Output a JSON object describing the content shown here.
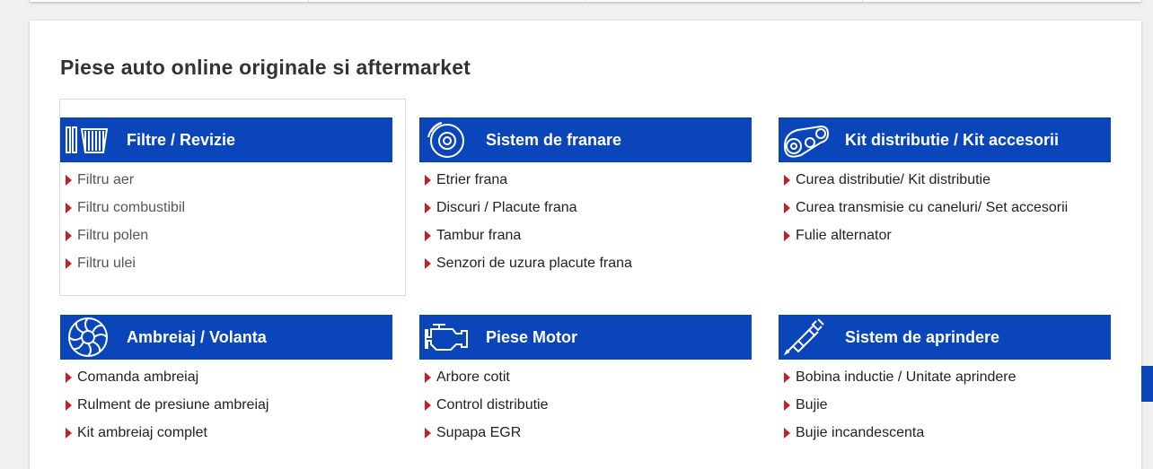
{
  "page_title": "Piese auto online originale si aftermarket",
  "categories": [
    {
      "title": "Filtre / Revizie",
      "icon": "filter-icon",
      "items": [
        "Filtru aer",
        "Filtru combustibil",
        "Filtru polen",
        "Filtru ulei"
      ]
    },
    {
      "title": "Sistem de franare",
      "icon": "brake-disc-icon",
      "items": [
        "Etrier frana",
        "Discuri / Placute frana",
        "Tambur frana",
        "Senzori de uzura placute frana"
      ]
    },
    {
      "title": "Kit distributie / Kit accesorii",
      "icon": "timing-belt-icon",
      "items": [
        "Curea distributie/ Kit distributie",
        "Curea transmisie cu caneluri/ Set accesorii",
        "Fulie alternator"
      ]
    },
    {
      "title": "Ambreiaj / Volanta",
      "icon": "clutch-icon",
      "items": [
        "Comanda ambreiaj",
        "Rulment de presiune ambreiaj",
        "Kit ambreiaj complet"
      ]
    },
    {
      "title": "Piese Motor",
      "icon": "engine-icon",
      "items": [
        "Arbore cotit",
        "Control distributie",
        "Supapa EGR"
      ]
    },
    {
      "title": "Sistem de aprindere",
      "icon": "spark-plug-icon",
      "items": [
        "Bobina inductie / Unitate aprindere",
        "Bujie",
        "Bujie incandescenta"
      ]
    }
  ],
  "colors": {
    "header_bg": "#0a45b9",
    "arrow": "#c0202b"
  }
}
